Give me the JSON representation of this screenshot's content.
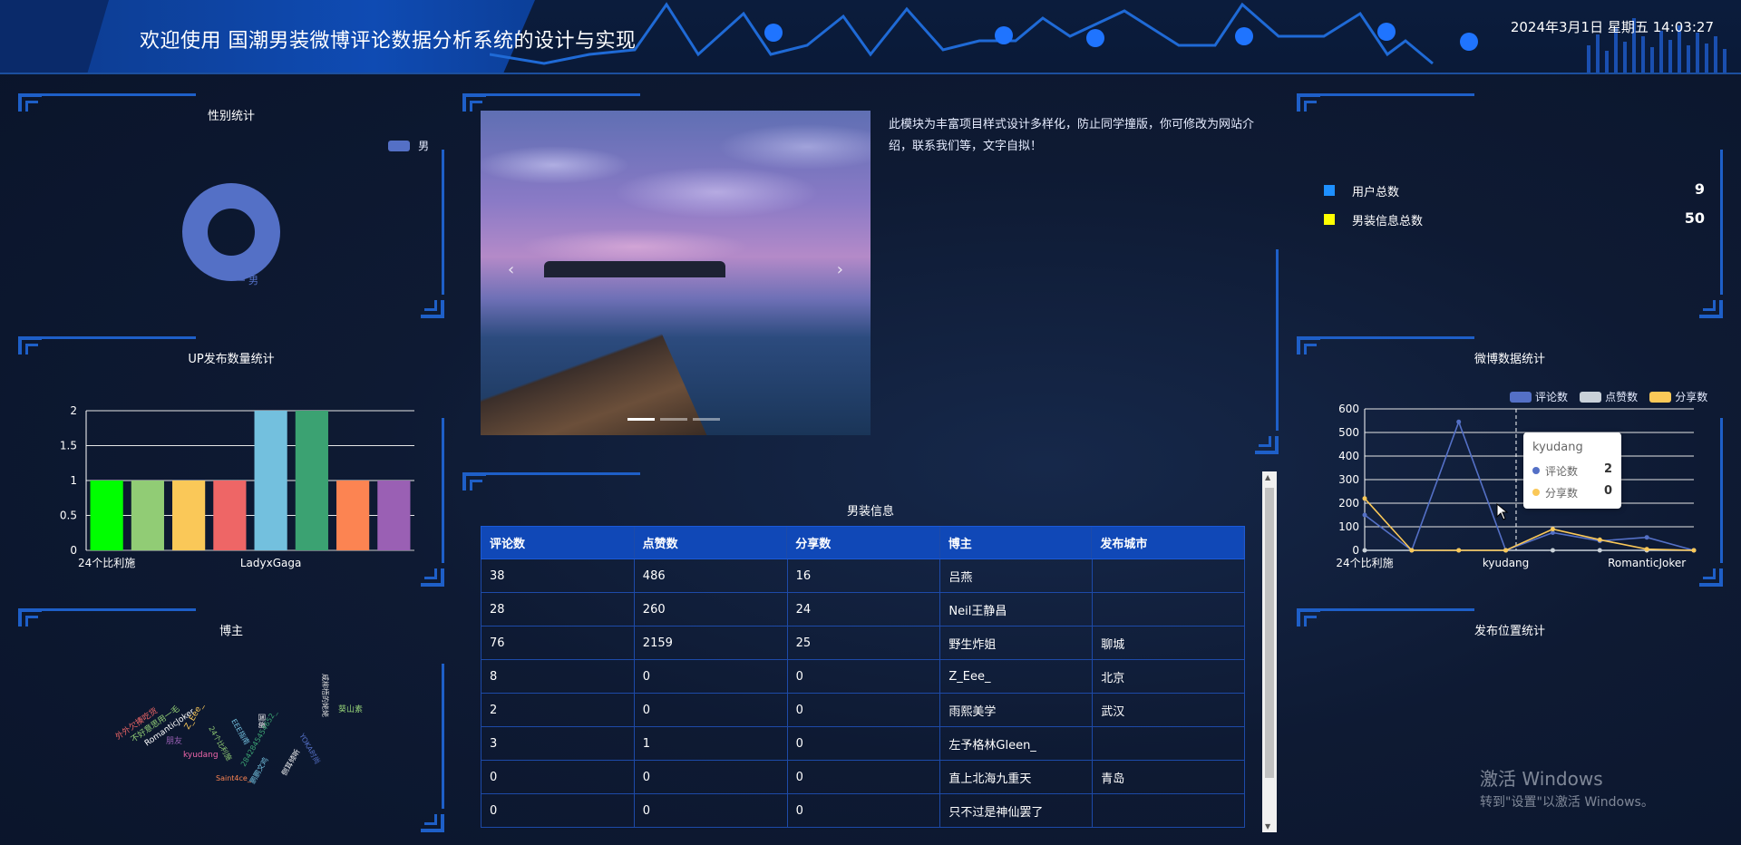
{
  "header": {
    "title": "欢迎使用 国潮男装微博评论数据分析系统的设计与实现",
    "datetime": "2024年3月1日 星期五 14:03:27"
  },
  "gender_panel": {
    "title": "性别统计",
    "legend": "男",
    "slice_label": "男",
    "chart_data": {
      "type": "pie",
      "categories": [
        "男"
      ],
      "values": [
        100
      ],
      "legend_position": "top-right"
    }
  },
  "up_panel": {
    "title": "UP发布数量统计",
    "chart_data": {
      "type": "bar",
      "x_tick_labels_shown": [
        "24个比利施",
        "LadyxGaga"
      ],
      "values": [
        1,
        1,
        1,
        1,
        2,
        2,
        1,
        1
      ],
      "bar_colors": [
        "#00ff00",
        "#91cc75",
        "#fac858",
        "#ee6666",
        "#73c0de",
        "#3ba272",
        "#fc8452",
        "#9a60b4"
      ],
      "y_ticks": [
        "0",
        "0.5",
        "1",
        "1.5",
        "2"
      ],
      "ylim": [
        0,
        2
      ]
    }
  },
  "blogger_panel": {
    "title": "博主",
    "words": [
      "外外欠揍吃货",
      "不好意思用一毛",
      "RomanticJoker",
      "朋友",
      "Z_Eee_",
      "24个比利施",
      "kyudang",
      "EEE指南",
      "国潮",
      "2842845454652_",
      "Saint4ce_",
      "鹏鹏文鸡",
      "侧耳倾听",
      "YOKA时尚",
      "咸柳梧的姥姥",
      "葵山素"
    ]
  },
  "intro": {
    "text": "此模块为丰富项目样式设计多样化，防止同学撞版，你可修改为网站介绍，联系我们等，文字自拟！",
    "prev_arrow": "‹",
    "next_arrow": "›"
  },
  "stats": {
    "items": [
      {
        "label": "用户总数",
        "value": "9",
        "color": "#1e90ff"
      },
      {
        "label": "男装信息总数",
        "value": "50",
        "color": "#ffff00"
      }
    ]
  },
  "weibo_panel": {
    "title": "微博数据统计",
    "legend": [
      "评论数",
      "点赞数",
      "分享数"
    ],
    "chart_data": {
      "type": "line",
      "x_tick_labels_shown": [
        "24个比利施",
        "kyudang",
        "RomanticJoker"
      ],
      "y_ticks": [
        "0",
        "100",
        "200",
        "300",
        "400",
        "500",
        "600"
      ],
      "ylim": [
        0,
        600
      ],
      "series": [
        {
          "name": "评论数",
          "color": "#5470c6",
          "values": [
            150,
            0,
            545,
            0,
            75,
            40,
            55,
            0
          ]
        },
        {
          "name": "点赞数",
          "color": "#c9d1d9",
          "values": [
            0,
            0,
            0,
            0,
            0,
            0,
            0,
            0
          ]
        },
        {
          "name": "分享数",
          "color": "#fac858",
          "values": [
            220,
            0,
            0,
            0,
            90,
            45,
            5,
            0
          ]
        }
      ]
    },
    "tooltip": {
      "title": "kyudang",
      "rows": [
        {
          "name": "评论数",
          "value": "2",
          "color": "#5470c6"
        },
        {
          "name": "分享数",
          "value": "0",
          "color": "#fac858"
        }
      ]
    }
  },
  "location_panel": {
    "title": "发布位置统计"
  },
  "table": {
    "title": "男装信息",
    "columns": [
      "评论数",
      "点赞数",
      "分享数",
      "博主",
      "发布城市"
    ],
    "rows": [
      [
        "38",
        "486",
        "16",
        "吕燕",
        ""
      ],
      [
        "28",
        "260",
        "24",
        "Neil王静昌",
        ""
      ],
      [
        "76",
        "2159",
        "25",
        "野生炸姐",
        "聊城"
      ],
      [
        "8",
        "0",
        "0",
        "Z_Eee_",
        "北京"
      ],
      [
        "2",
        "0",
        "0",
        "雨熙美学",
        "武汉"
      ],
      [
        "3",
        "1",
        "0",
        "左予格林Gleen_",
        ""
      ],
      [
        "0",
        "0",
        "0",
        "直上北海九重天",
        "青岛"
      ],
      [
        "0",
        "0",
        "0",
        "只不过是神仙罢了",
        ""
      ]
    ]
  },
  "watermark": {
    "line1": "激活 Windows",
    "line2": "转到\"设置\"以激活 Windows。"
  }
}
